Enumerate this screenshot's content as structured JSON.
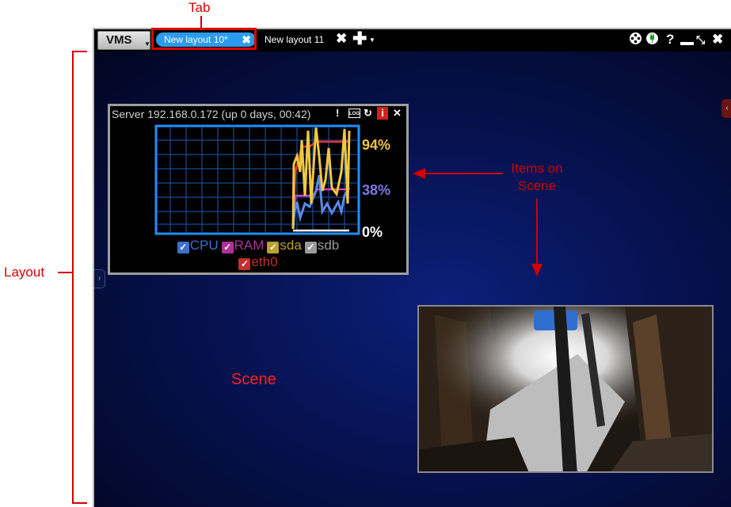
{
  "annotations": {
    "tab": "Tab",
    "items_on_scene_line1": "Items on",
    "items_on_scene_line2": "Scene",
    "layout": "Layout",
    "scene": "Scene"
  },
  "titlebar": {
    "vms_label": "VMS",
    "tabs": [
      {
        "label": "New layout 10*",
        "active": true
      },
      {
        "label": "New layout 11",
        "active": false
      }
    ],
    "close_glyph": "✖",
    "add_glyph": "✚"
  },
  "window_controls": [
    "film-reel-icon",
    "plug-icon",
    "help-icon",
    "minimize-icon",
    "fullscreen-icon",
    "close-icon"
  ],
  "server_item": {
    "title": "Server 192.168.0.172 (up 0 days, 00:42)",
    "toolbar_icons": [
      "alert-icon",
      "log-icon",
      "refresh-icon",
      "info-icon",
      "close-icon"
    ],
    "log_label": "LOG",
    "info_label": "i",
    "pct_high": "94%",
    "pct_mid": "38%",
    "pct_low": "0%",
    "legend": [
      {
        "label": "CPU",
        "color": "#3c6fd0",
        "checked": true
      },
      {
        "label": "RAM",
        "color": "#b0309a",
        "checked": true
      },
      {
        "label": "sda",
        "color": "#b8a12e",
        "checked": true
      },
      {
        "label": "sdb",
        "color": "#9a9a9a",
        "checked": true
      },
      {
        "label": "eth0",
        "color": "#c03030",
        "checked": true
      }
    ]
  },
  "colors": {
    "tab_active": "#2a9cf0",
    "annotation": "#d40000",
    "chart_frame": "#1e8fff",
    "chart_grid": "#1a4a9a",
    "cpu": "#5a88e8",
    "ram": "#d040c0",
    "sda": "#f0c840",
    "eth0": "#e83030",
    "scene": "#0c1f7a"
  }
}
